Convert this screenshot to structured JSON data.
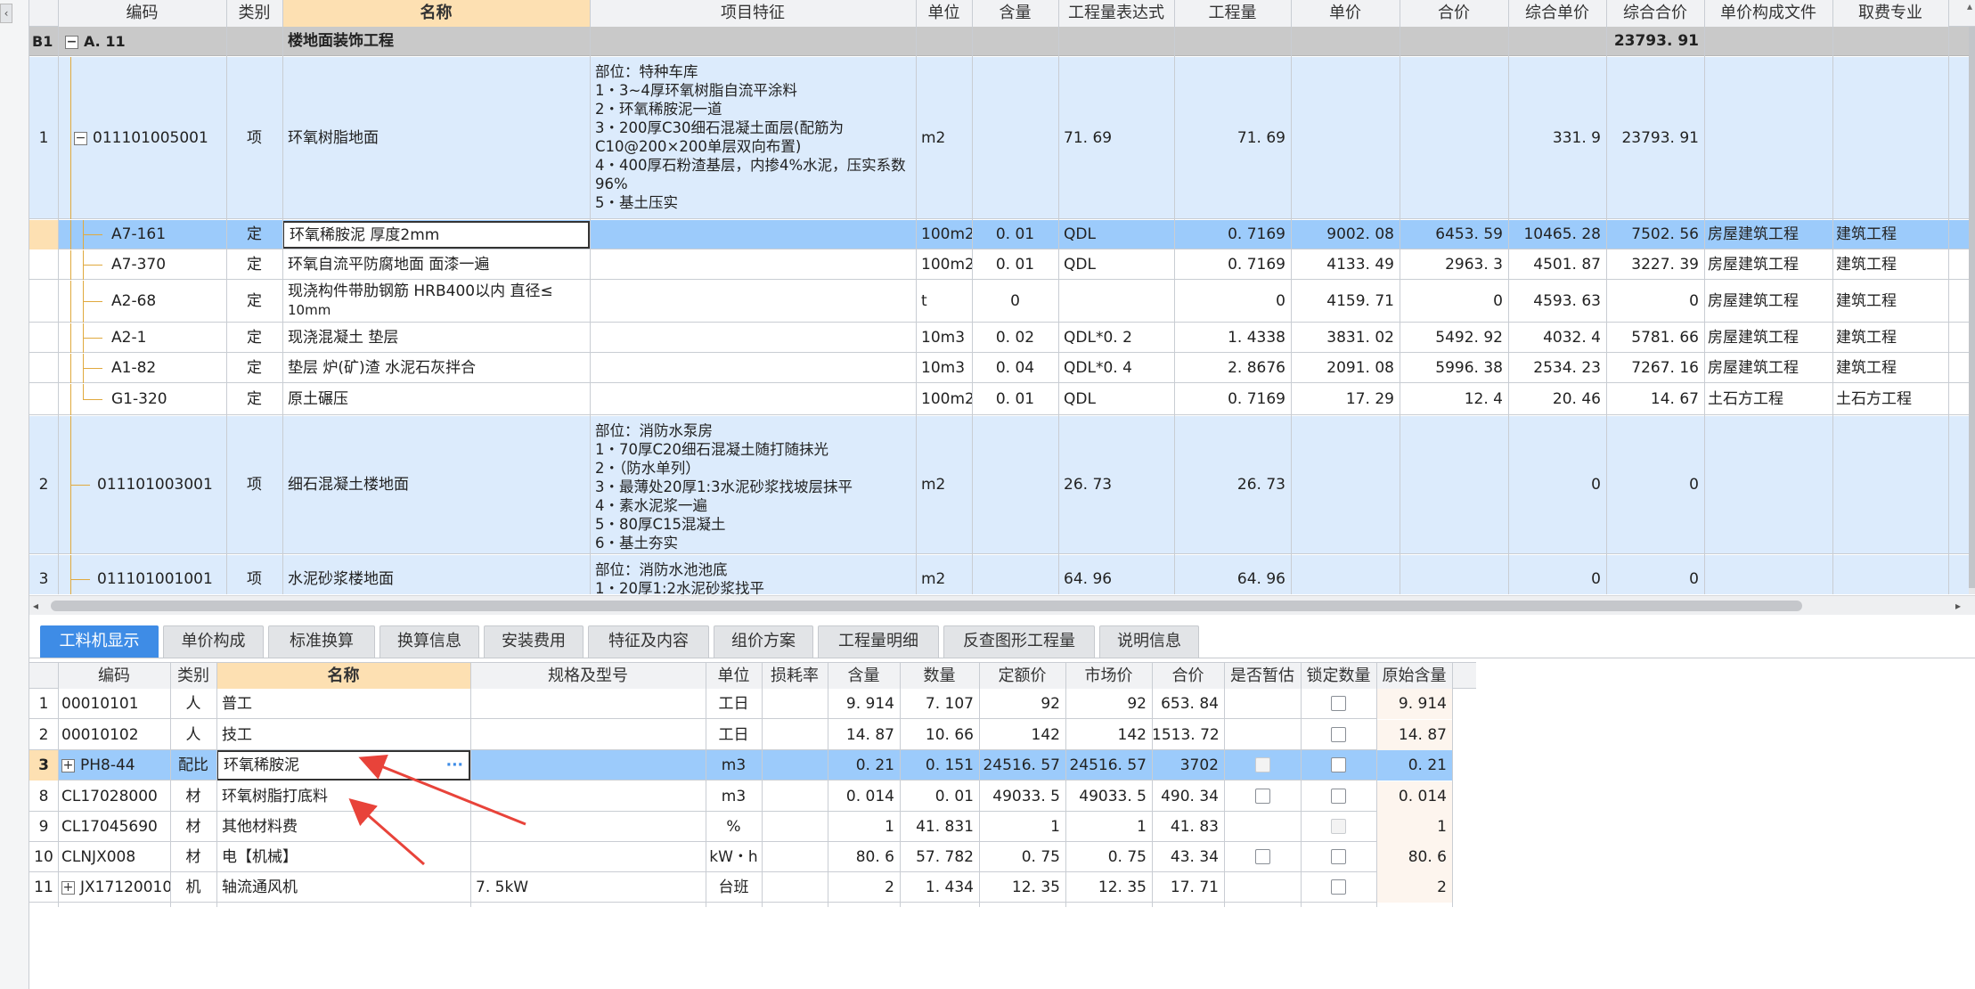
{
  "top": {
    "headers": [
      "编码",
      "类别",
      "名称",
      "项目特征",
      "单位",
      "含量",
      "工程量表达式",
      "工程量",
      "单价",
      "合价",
      "综合单价",
      "综合合价",
      "单价构成文件",
      "取费专业"
    ],
    "section": {
      "id": "B1",
      "code": "A. 11",
      "name": "楼地面装饰工程",
      "total": "23793. 91"
    },
    "item1": {
      "row": "1",
      "code": "011101005001",
      "type": "项",
      "name": "环氧树脂地面",
      "feature": [
        "部位：特种车库",
        "1・3~4厚环氧树脂自流平涂料",
        "2・环氧稀胺泥一道",
        "3・200厚C30细石混凝土面层(配筋为",
        "C10@200×200单层双向布置)",
        "4・400厚石粉渣基层，内掺4%水泥，压实系数",
        "96%",
        "5・基土压实"
      ],
      "unit": "m2",
      "expr": "71. 69",
      "qty": "71. 69",
      "comp_price": "331. 9",
      "comp_total": "23793. 91"
    },
    "subs": [
      {
        "code": "A7-161",
        "type": "定",
        "name": "环氧稀胺泥 厚度2mm",
        "unit": "100m2",
        "content": "0. 01",
        "expr": "QDL",
        "qty": "0. 7169",
        "price": "9002. 08",
        "total": "6453. 59",
        "comp_price": "10465. 28",
        "comp_total": "7502. 56",
        "file": "房屋建筑工程",
        "major": "建筑工程"
      },
      {
        "code": "A7-370",
        "type": "定",
        "name": "环氧自流平防腐地面 面漆一遍",
        "unit": "100m2",
        "content": "0. 01",
        "expr": "QDL",
        "qty": "0. 7169",
        "price": "4133. 49",
        "total": "2963. 3",
        "comp_price": "4501. 87",
        "comp_total": "3227. 39",
        "file": "房屋建筑工程",
        "major": "建筑工程"
      },
      {
        "code": "A2-68",
        "type": "定",
        "name": "现浇构件带肋钢筋 HRB400以内 直径≤",
        "name2": "10mm",
        "unit": "t",
        "content": "0",
        "expr": "",
        "qty": "0",
        "price": "4159. 71",
        "total": "0",
        "comp_price": "4593. 63",
        "comp_total": "0",
        "file": "房屋建筑工程",
        "major": "建筑工程"
      },
      {
        "code": "A2-1",
        "type": "定",
        "name": "现浇混凝土 垫层",
        "unit": "10m3",
        "content": "0. 02",
        "expr": "QDL*0. 2",
        "qty": "1. 4338",
        "price": "3831. 02",
        "total": "5492. 92",
        "comp_price": "4032. 4",
        "comp_total": "5781. 66",
        "file": "房屋建筑工程",
        "major": "建筑工程"
      },
      {
        "code": "A1-82",
        "type": "定",
        "name": "垫层 炉(矿)渣 水泥石灰拌合",
        "unit": "10m3",
        "content": "0. 04",
        "expr": "QDL*0. 4",
        "qty": "2. 8676",
        "price": "2091. 08",
        "total": "5996. 38",
        "comp_price": "2534. 23",
        "comp_total": "7267. 16",
        "file": "房屋建筑工程",
        "major": "建筑工程"
      },
      {
        "code": "G1-320",
        "type": "定",
        "name": "原土碾压",
        "unit": "100m2",
        "content": "0. 01",
        "expr": "QDL",
        "qty": "0. 7169",
        "price": "17. 29",
        "total": "12. 4",
        "comp_price": "20. 46",
        "comp_total": "14. 67",
        "file": "土石方工程",
        "major": "土石方工程"
      }
    ],
    "item2": {
      "row": "2",
      "code": "011101003001",
      "type": "项",
      "name": "细石混凝土楼地面",
      "feature": [
        "部位：消防水泵房",
        "1・70厚C20细石混凝土随打随抹光",
        "2・（防水单列）",
        "3・最薄处20厚1:3水泥砂浆找坡层抹平",
        "4・素水泥浆一遍",
        "5・80厚C15混凝土",
        "6・基土夯实"
      ],
      "unit": "m2",
      "expr": "26. 73",
      "qty": "26. 73",
      "comp_price": "0",
      "comp_total": "0"
    },
    "item3": {
      "row": "3",
      "code": "011101001001",
      "type": "项",
      "name": "水泥砂浆楼地面",
      "feature": [
        "部位：消防水池池底",
        "1・20厚1:2水泥砂浆找平"
      ],
      "unit": "m2",
      "expr": "64. 96",
      "qty": "64. 96",
      "comp_price": "0",
      "comp_total": "0"
    }
  },
  "tabs": [
    "工料机显示",
    "单价构成",
    "标准换算",
    "换算信息",
    "安装费用",
    "特征及内容",
    "组价方案",
    "工程量明细",
    "反查图形工程量",
    "说明信息"
  ],
  "bottom": {
    "headers": [
      "编码",
      "类别",
      "名称",
      "规格及型号",
      "单位",
      "损耗率",
      "含量",
      "数量",
      "定额价",
      "市场价",
      "合价",
      "是否暂估",
      "锁定数量",
      "原始含量"
    ],
    "rows": [
      {
        "no": "1",
        "code": "00010101",
        "type": "人",
        "name": "普工",
        "spec": "",
        "unit": "工日",
        "content": "9. 914",
        "qty": "7. 107",
        "quota": "92",
        "market": "92",
        "total": "653. 84",
        "est": "",
        "orig": "9. 914"
      },
      {
        "no": "2",
        "code": "00010102",
        "type": "人",
        "name": "技工",
        "spec": "",
        "unit": "工日",
        "content": "14. 87",
        "qty": "10. 66",
        "quota": "142",
        "market": "142",
        "total": "1513. 72",
        "est": "",
        "orig": "14. 87"
      },
      {
        "no": "3",
        "code": "PH8-44",
        "type": "配比",
        "name": "环氧稀胺泥",
        "spec": "",
        "unit": "m3",
        "content": "0. 21",
        "qty": "0. 151",
        "quota": "24516. 57",
        "market": "24516. 57",
        "total": "3702",
        "est": "dim",
        "orig": "0. 21"
      },
      {
        "no": "8",
        "code": "CL17028000",
        "type": "材",
        "name": "环氧树脂打底料",
        "spec": "",
        "unit": "m3",
        "content": "0. 014",
        "qty": "0. 01",
        "quota": "49033. 5",
        "market": "49033. 5",
        "total": "490. 34",
        "est": "box",
        "orig": "0. 014"
      },
      {
        "no": "9",
        "code": "CL17045690",
        "type": "材",
        "name": "其他材料费",
        "spec": "",
        "unit": "%",
        "content": "1",
        "qty": "41. 831",
        "quota": "1",
        "market": "1",
        "total": "41. 83",
        "est": "",
        "orig": "1"
      },
      {
        "no": "10",
        "code": "CLNJX008",
        "type": "材",
        "name": "电【机械】",
        "spec": "",
        "unit": "kW・h",
        "content": "80. 6",
        "qty": "57. 782",
        "quota": "0. 75",
        "market": "0. 75",
        "total": "43. 34",
        "est": "box",
        "orig": "80. 6"
      },
      {
        "no": "11",
        "code": "JX17120010",
        "type": "机",
        "name": "轴流通风机",
        "spec": "7. 5kW",
        "unit": "台班",
        "content": "2",
        "qty": "1. 434",
        "quota": "12. 35",
        "market": "12. 35",
        "total": "17. 71",
        "est": "",
        "orig": "2"
      }
    ]
  },
  "colors": {
    "selected": "#9ccbfb",
    "item": "#dcebfc",
    "section": "#c9c9c9",
    "accent": "#3e8ce6",
    "arrow": "#e8433a"
  }
}
